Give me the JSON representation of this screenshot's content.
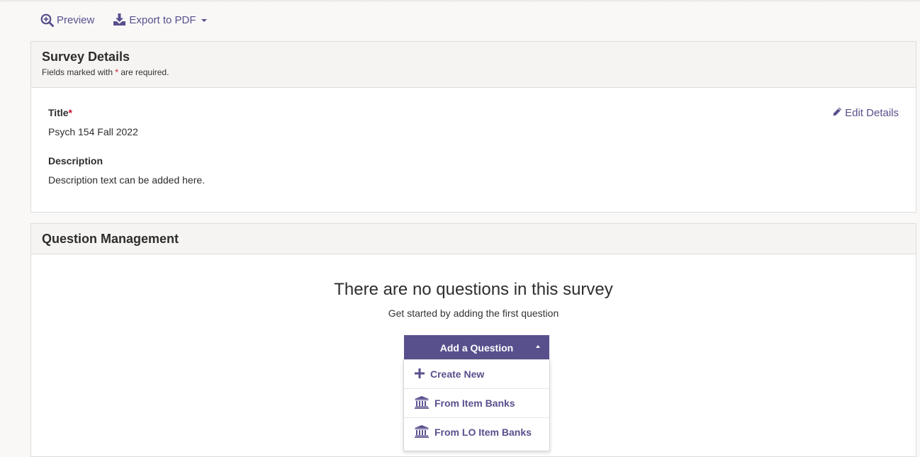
{
  "toolbar": {
    "preview_label": "Preview",
    "export_label": "Export to PDF"
  },
  "survey_details": {
    "heading": "Survey Details",
    "required_note_prefix": "Fields marked with ",
    "required_star": "*",
    "required_note_suffix": " are required.",
    "edit_label": "Edit Details",
    "title_label": "Title",
    "title_value": "Psych 154 Fall 2022",
    "description_label": "Description",
    "description_value": "Description text can be added here."
  },
  "question_management": {
    "heading": "Question Management",
    "empty_title": "There are no questions in this survey",
    "empty_subtitle": "Get started by adding the first question",
    "add_button_label": "Add a Question",
    "menu_items": [
      {
        "label": "Create New",
        "icon": "plus-icon"
      },
      {
        "label": "From Item Banks",
        "icon": "bank-icon"
      },
      {
        "label": "From LO Item Banks",
        "icon": "bank-icon"
      }
    ]
  },
  "colors": {
    "accent": "#58508d",
    "required": "#c8102e",
    "panel_header": "#f5f4f3"
  }
}
